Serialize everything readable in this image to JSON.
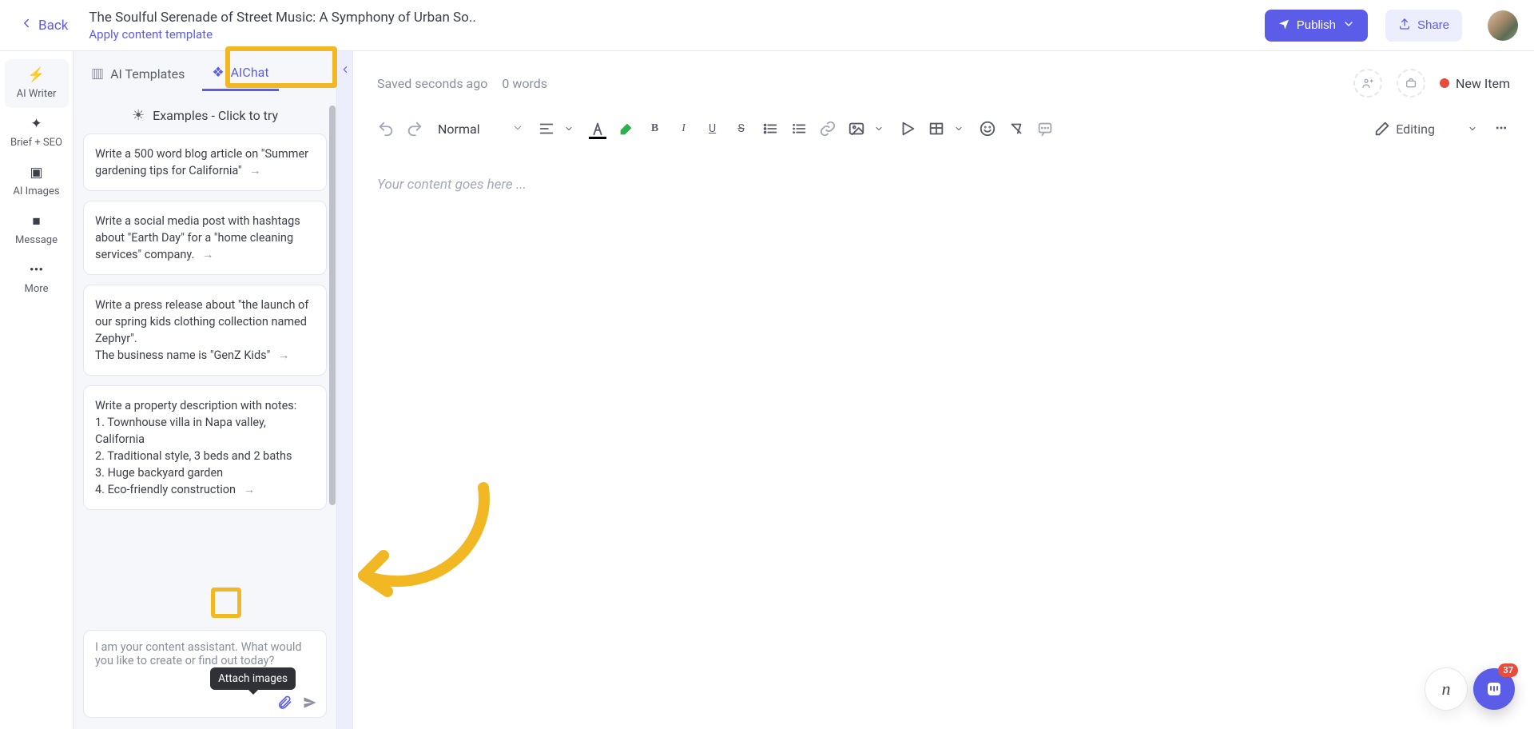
{
  "header": {
    "back_label": "Back",
    "title": "The Soulful Serenade of Street Music: A Symphony of Urban So..",
    "apply_template": "Apply content template",
    "publish_label": "Publish",
    "share_label": "Share"
  },
  "rail": {
    "items": [
      {
        "icon": "bolt",
        "label": "AI Writer"
      },
      {
        "icon": "target",
        "label": "Brief + SEO"
      },
      {
        "icon": "image",
        "label": "AI Images"
      },
      {
        "icon": "message",
        "label": "Message"
      },
      {
        "icon": "dots",
        "label": "More"
      }
    ]
  },
  "side": {
    "tabs": {
      "templates": "AI Templates",
      "chat": "AIChat"
    },
    "examples_header": "Examples - Click to try",
    "examples": [
      "Write a 500 word blog article on \"Summer gardening tips for California\"",
      "Write a social media post with hashtags about \"Earth Day\" for a \"home cleaning services\" company.",
      "Write a press release about \"the launch of our spring kids clothing collection named Zephyr\".\nThe business name is \"GenZ Kids\"",
      "Write a property description with notes:\n1. Townhouse villa in Napa valley, California\n2. Traditional style, 3 beds and 2 baths\n3. Huge backyard garden\n4. Eco-friendly construction"
    ],
    "chat_placeholder": "I am your content assistant. What would you like to create or find out today?",
    "tooltip_attach": "Attach images"
  },
  "editor": {
    "status_saved": "Saved seconds ago",
    "word_count": "0 words",
    "new_item_label": "New Item",
    "style_name": "Normal",
    "mode_label": "Editing",
    "placeholder": "Your content goes here ..."
  },
  "intercom_badge": "37"
}
